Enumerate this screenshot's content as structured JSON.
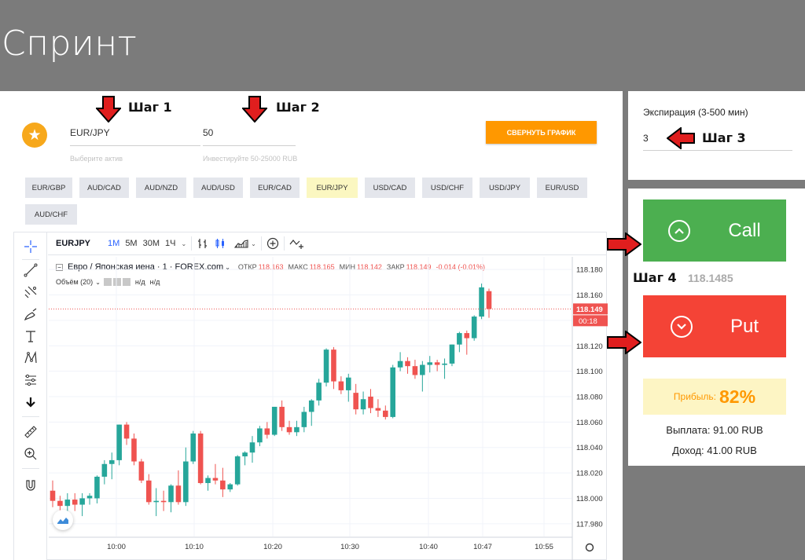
{
  "page": {
    "title": "Спринт"
  },
  "asset": {
    "value": "EUR/JPY",
    "hint": "Выберите актив"
  },
  "investment": {
    "value": "50",
    "hint": "Инвестируйте 50-25000 RUB"
  },
  "steps": {
    "step1": "Шаг 1",
    "step2": "Шаг 2",
    "step3": "Шаг 3",
    "step4": "Шаг 4"
  },
  "collapse_button": "СВЕРНУТЬ ГРАФИК",
  "pairs": [
    "EUR/GBP",
    "AUD/CAD",
    "AUD/NZD",
    "AUD/USD",
    "EUR/CAD",
    "EUR/JPY",
    "USD/CAD",
    "USD/CHF",
    "USD/JPY",
    "EUR/USD",
    "AUD/CHF"
  ],
  "active_pair": "EUR/JPY",
  "chart_toolbar": {
    "symbol": "EURJPY",
    "timeframes": [
      "1M",
      "5M",
      "30M",
      "1Ч"
    ]
  },
  "legend": {
    "name": "Евро / Японская иена · 1 · FOREX.com",
    "open_label": "ОТКР",
    "open": "118.163",
    "high_label": "МАКС",
    "high": "118.165",
    "low_label": "МИН",
    "low": "118.142",
    "close_label": "ЗАКР",
    "close": "118.149",
    "change": "-0.014 (-0.01%)",
    "volume_label": "Объём (20)",
    "volume_na1": "н/д",
    "volume_na2": "н/д"
  },
  "chart_data": {
    "type": "candlestick",
    "y_ticks": [
      "118.180",
      "118.160",
      "118.140",
      "118.120",
      "118.100",
      "118.080",
      "118.060",
      "118.040",
      "118.020",
      "118.000",
      "117.980"
    ],
    "x_ticks": [
      "10:00",
      "10:10",
      "10:20",
      "10:30",
      "10:40",
      "10:47",
      "10:55"
    ],
    "ylim": [
      117.97,
      118.19
    ],
    "last_price": "118.149",
    "countdown": "00:18",
    "up_color": "#26a69a",
    "down_color": "#ef5350",
    "candles": [
      {
        "o": 118.006,
        "h": 118.014,
        "l": 117.993,
        "c": 117.998
      },
      {
        "o": 117.998,
        "h": 118.002,
        "l": 117.99,
        "c": 117.994
      },
      {
        "o": 117.994,
        "h": 118.004,
        "l": 117.988,
        "c": 117.999
      },
      {
        "o": 117.999,
        "h": 118.004,
        "l": 117.99,
        "c": 117.995
      },
      {
        "o": 117.995,
        "h": 118.004,
        "l": 117.986,
        "c": 118.0
      },
      {
        "o": 118.0,
        "h": 118.004,
        "l": 117.995,
        "c": 118.002
      },
      {
        "o": 118.0,
        "h": 118.018,
        "l": 117.996,
        "c": 118.017
      },
      {
        "o": 118.017,
        "h": 118.03,
        "l": 118.011,
        "c": 118.027
      },
      {
        "o": 118.027,
        "h": 118.036,
        "l": 118.015,
        "c": 118.03
      },
      {
        "o": 118.03,
        "h": 118.058,
        "l": 118.026,
        "c": 118.058
      },
      {
        "o": 118.058,
        "h": 118.06,
        "l": 118.042,
        "c": 118.047
      },
      {
        "o": 118.047,
        "h": 118.051,
        "l": 118.026,
        "c": 118.029
      },
      {
        "o": 118.029,
        "h": 118.031,
        "l": 118.012,
        "c": 118.014
      },
      {
        "o": 118.014,
        "h": 118.019,
        "l": 117.995,
        "c": 117.997
      },
      {
        "o": 117.997,
        "h": 118.008,
        "l": 117.986,
        "c": 117.998
      },
      {
        "o": 117.998,
        "h": 118.006,
        "l": 117.99,
        "c": 117.997
      },
      {
        "o": 117.997,
        "h": 118.011,
        "l": 117.989,
        "c": 118.01
      },
      {
        "o": 118.01,
        "h": 118.022,
        "l": 117.995,
        "c": 117.997
      },
      {
        "o": 117.997,
        "h": 118.04,
        "l": 117.994,
        "c": 118.029
      },
      {
        "o": 118.029,
        "h": 118.053,
        "l": 118.027,
        "c": 118.051
      },
      {
        "o": 118.051,
        "h": 118.053,
        "l": 118.011,
        "c": 118.012
      },
      {
        "o": 118.012,
        "h": 118.018,
        "l": 118.006,
        "c": 118.016
      },
      {
        "o": 118.016,
        "h": 118.027,
        "l": 118.011,
        "c": 118.014
      },
      {
        "o": 118.014,
        "h": 118.024,
        "l": 118.001,
        "c": 118.007
      },
      {
        "o": 118.007,
        "h": 118.012,
        "l": 118.005,
        "c": 118.011
      },
      {
        "o": 118.011,
        "h": 118.034,
        "l": 118.01,
        "c": 118.033
      },
      {
        "o": 118.033,
        "h": 118.037,
        "l": 118.026,
        "c": 118.036
      },
      {
        "o": 118.036,
        "h": 118.049,
        "l": 118.028,
        "c": 118.044
      },
      {
        "o": 118.044,
        "h": 118.057,
        "l": 118.041,
        "c": 118.055
      },
      {
        "o": 118.055,
        "h": 118.06,
        "l": 118.047,
        "c": 118.05
      },
      {
        "o": 118.05,
        "h": 118.072,
        "l": 118.049,
        "c": 118.072
      },
      {
        "o": 118.072,
        "h": 118.077,
        "l": 118.053,
        "c": 118.056
      },
      {
        "o": 118.056,
        "h": 118.061,
        "l": 118.05,
        "c": 118.052
      },
      {
        "o": 118.052,
        "h": 118.061,
        "l": 118.049,
        "c": 118.056
      },
      {
        "o": 118.056,
        "h": 118.072,
        "l": 118.052,
        "c": 118.068
      },
      {
        "o": 118.068,
        "h": 118.078,
        "l": 118.057,
        "c": 118.077
      },
      {
        "o": 118.077,
        "h": 118.094,
        "l": 118.073,
        "c": 118.091
      },
      {
        "o": 118.091,
        "h": 118.118,
        "l": 118.088,
        "c": 118.117
      },
      {
        "o": 118.117,
        "h": 118.119,
        "l": 118.086,
        "c": 118.092
      },
      {
        "o": 118.092,
        "h": 118.096,
        "l": 118.082,
        "c": 118.085
      },
      {
        "o": 118.085,
        "h": 118.098,
        "l": 118.076,
        "c": 118.095
      },
      {
        "o": 118.083,
        "h": 118.09,
        "l": 118.066,
        "c": 118.07
      },
      {
        "o": 118.07,
        "h": 118.084,
        "l": 118.066,
        "c": 118.078
      },
      {
        "o": 118.08,
        "h": 118.086,
        "l": 118.067,
        "c": 118.071
      },
      {
        "o": 118.071,
        "h": 118.078,
        "l": 118.064,
        "c": 118.069
      },
      {
        "o": 118.069,
        "h": 118.073,
        "l": 118.062,
        "c": 118.064
      },
      {
        "o": 118.064,
        "h": 118.105,
        "l": 118.063,
        "c": 118.103
      },
      {
        "o": 118.103,
        "h": 118.115,
        "l": 118.1,
        "c": 118.108
      },
      {
        "o": 118.108,
        "h": 118.111,
        "l": 118.098,
        "c": 118.104
      },
      {
        "o": 118.104,
        "h": 118.109,
        "l": 118.094,
        "c": 118.097
      },
      {
        "o": 118.097,
        "h": 118.108,
        "l": 118.084,
        "c": 118.105
      },
      {
        "o": 118.105,
        "h": 118.112,
        "l": 118.099,
        "c": 118.107
      },
      {
        "o": 118.107,
        "h": 118.109,
        "l": 118.1,
        "c": 118.105
      },
      {
        "o": 118.105,
        "h": 118.11,
        "l": 118.094,
        "c": 118.106
      },
      {
        "o": 118.106,
        "h": 118.121,
        "l": 118.104,
        "c": 118.121
      },
      {
        "o": 118.121,
        "h": 118.131,
        "l": 118.115,
        "c": 118.13
      },
      {
        "o": 118.13,
        "h": 118.132,
        "l": 118.113,
        "c": 118.126
      },
      {
        "o": 118.126,
        "h": 118.144,
        "l": 118.124,
        "c": 118.143
      },
      {
        "o": 118.143,
        "h": 118.169,
        "l": 118.141,
        "c": 118.166
      },
      {
        "o": 118.163,
        "h": 118.165,
        "l": 118.142,
        "c": 118.149
      }
    ]
  },
  "expiry": {
    "label": "Экспирация (3-500 мин)",
    "value": "3"
  },
  "call_label": "Call",
  "put_label": "Put",
  "current_price": "118.1485",
  "profit": {
    "label": "Прибыль:",
    "value": "82%"
  },
  "payout": "Выплата: 91.00 RUB",
  "income": "Доход: 41.00 RUB",
  "colors": {
    "accent": "#ff9800",
    "call": "#4caf50",
    "put": "#f44336",
    "star": "#f7a81b"
  }
}
